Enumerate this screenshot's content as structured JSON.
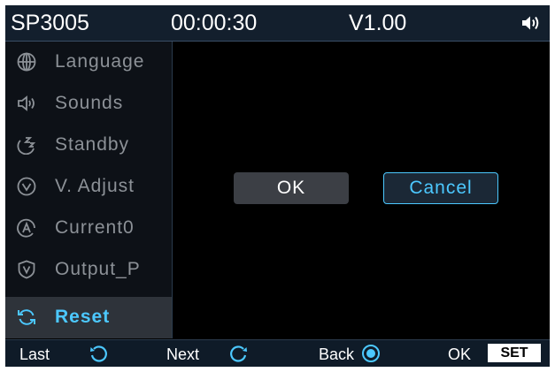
{
  "header": {
    "model": "SP3005",
    "timer": "00:00:30",
    "version": "V1.00",
    "volume_icon": "speaker-volume-icon"
  },
  "menu": {
    "items": [
      {
        "label": "Language",
        "icon": "globe-icon"
      },
      {
        "label": "Sounds",
        "icon": "speaker-icon"
      },
      {
        "label": "Standby",
        "icon": "moon-sleep-icon"
      },
      {
        "label": "V. Adjust",
        "icon": "voltage-adjust-icon"
      },
      {
        "label": "Current0",
        "icon": "current-zero-icon"
      },
      {
        "label": "Output_P",
        "icon": "shield-v-icon"
      },
      {
        "label": "Reset",
        "icon": "reset-icon",
        "selected": true
      }
    ]
  },
  "dialog": {
    "ok_label": "OK",
    "cancel_label": "Cancel",
    "focused": "Cancel"
  },
  "footer": {
    "last_label": "Last",
    "next_label": "Next",
    "back_label": "Back",
    "ok_label": "OK",
    "set_label": "SET"
  },
  "colors": {
    "accent": "#4cc8ff",
    "header_bg": "#131f2d",
    "sidebar_active_bg": "#2e333a",
    "text_dim": "#8c9197"
  }
}
